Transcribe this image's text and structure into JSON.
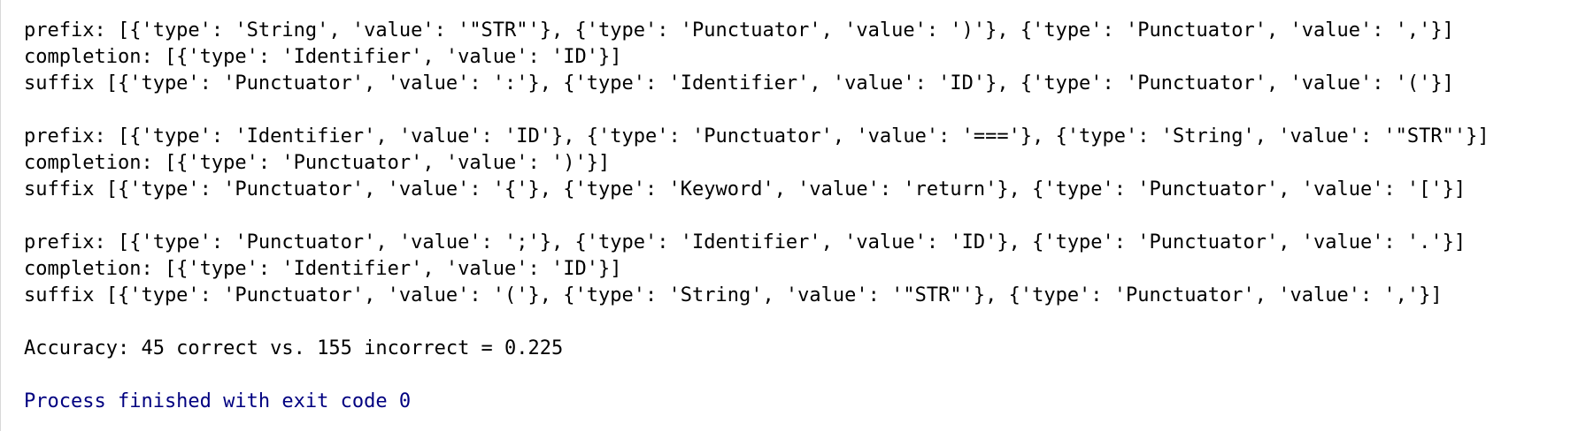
{
  "console": {
    "blocks": [
      {
        "prefix": "prefix: [{'type': 'String', 'value': '\"STR\"'}, {'type': 'Punctuator', 'value': ')'}, {'type': 'Punctuator', 'value': ','}]",
        "completion": "completion: [{'type': 'Identifier', 'value': 'ID'}]",
        "suffix": "suffix [{'type': 'Punctuator', 'value': ':'}, {'type': 'Identifier', 'value': 'ID'}, {'type': 'Punctuator', 'value': '('}]"
      },
      {
        "prefix": "prefix: [{'type': 'Identifier', 'value': 'ID'}, {'type': 'Punctuator', 'value': '==='}, {'type': 'String', 'value': '\"STR\"'}]",
        "completion": "completion: [{'type': 'Punctuator', 'value': ')'}]",
        "suffix": "suffix [{'type': 'Punctuator', 'value': '{'}, {'type': 'Keyword', 'value': 'return'}, {'type': 'Punctuator', 'value': '['}]"
      },
      {
        "prefix": "prefix: [{'type': 'Punctuator', 'value': ';'}, {'type': 'Identifier', 'value': 'ID'}, {'type': 'Punctuator', 'value': '.'}]",
        "completion": "completion: [{'type': 'Identifier', 'value': 'ID'}]",
        "suffix": "suffix [{'type': 'Punctuator', 'value': '('}, {'type': 'String', 'value': '\"STR\"'}, {'type': 'Punctuator', 'value': ','}]"
      }
    ],
    "accuracy_line": "Accuracy: 45 correct vs. 155 incorrect = 0.225",
    "exit_line": "Process finished with exit code 0"
  },
  "colors": {
    "text": "#000000",
    "exit_text": "#000080",
    "background": "#ffffff"
  }
}
